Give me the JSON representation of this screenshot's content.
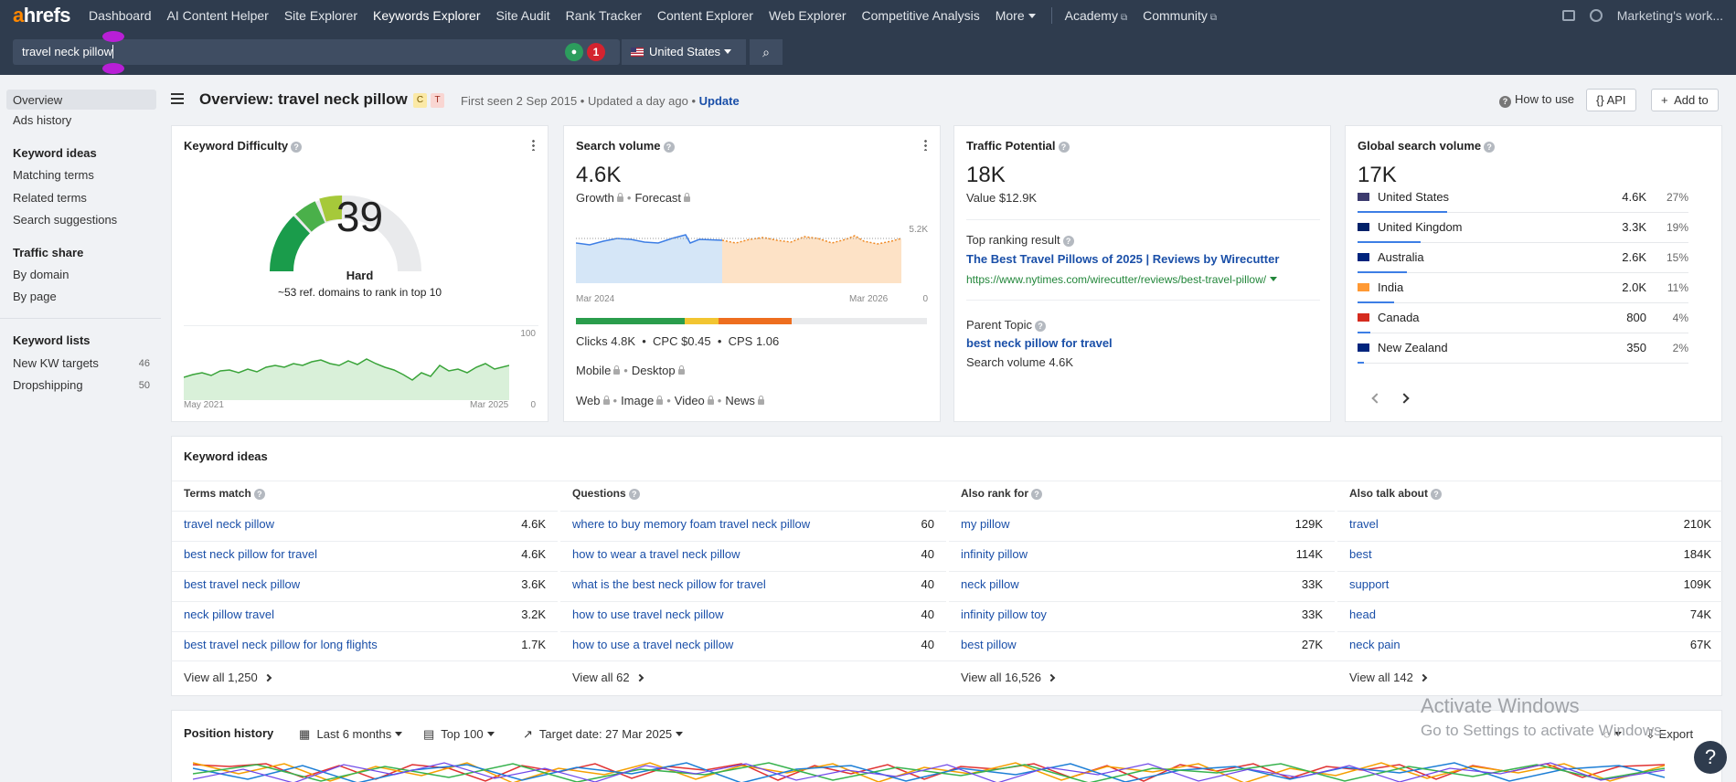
{
  "nav": {
    "logo_a": "a",
    "logo_rest": "hrefs",
    "items": [
      "Dashboard",
      "AI Content Helper",
      "Site Explorer",
      "Keywords Explorer",
      "Site Audit",
      "Rank Tracker",
      "Content Explorer",
      "Web Explorer",
      "Competitive Analysis",
      "More"
    ],
    "academy": "Academy",
    "community": "Community",
    "workspace": "Marketing's work..."
  },
  "search": {
    "query": "travel neck pillow",
    "badge_count": "1",
    "country": "United States"
  },
  "sidebar": {
    "overview": "Overview",
    "ads_history": "Ads history",
    "keyword_ideas_head": "Keyword ideas",
    "matching_terms": "Matching terms",
    "related_terms": "Related terms",
    "search_suggestions": "Search suggestions",
    "traffic_share_head": "Traffic share",
    "by_domain": "By domain",
    "by_page": "By page",
    "keyword_lists_head": "Keyword lists",
    "list1": {
      "name": "New KW targets",
      "count": "46"
    },
    "list2": {
      "name": "Dropshipping",
      "count": "50"
    }
  },
  "header": {
    "title": "Overview: travel neck pillow",
    "tag_c": "C",
    "tag_t": "T",
    "meta": "First seen 2 Sep 2015 • Updated a day ago •",
    "update": "Update",
    "how_to_use": "How to use",
    "api": "API",
    "add_to": "Add to"
  },
  "kd": {
    "title": "Keyword Difficulty",
    "value": "39",
    "label": "Hard",
    "note": "~53 ref. domains to rank in top 10",
    "axis_max": "100",
    "axis_min": "0",
    "date_start": "May 2021",
    "date_end": "Mar 2025"
  },
  "sv": {
    "title": "Search volume",
    "value": "4.6K",
    "growth": "Growth",
    "forecast": "Forecast",
    "axis_max": "5.2K",
    "axis_min": "0",
    "date_start": "Mar 2024",
    "date_end": "Mar 2026",
    "metrics": "Clicks 4.8K  •  CPC $0.45  •  CPS 1.06",
    "mobile": "Mobile",
    "desktop": "Desktop",
    "web": "Web",
    "image": "Image",
    "video": "Video",
    "news": "News"
  },
  "tp": {
    "title": "Traffic Potential",
    "value": "18K",
    "value_usd": "Value $12.9K",
    "top_label": "Top ranking result",
    "top_title": "The Best Travel Pillows of 2025 | Reviews by Wirecutter",
    "top_url": "https://www.nytimes.com/wirecutter/reviews/best-travel-pillow/",
    "parent_label": "Parent Topic",
    "parent_kw": "best neck pillow for travel",
    "parent_sv": "Search volume 4.6K"
  },
  "gsv": {
    "title": "Global search volume",
    "value": "17K",
    "rows": [
      {
        "name": "United States",
        "vol": "4.6K",
        "pct": "27%",
        "share": 0.27,
        "flag": "us"
      },
      {
        "name": "United Kingdom",
        "vol": "3.3K",
        "pct": "19%",
        "share": 0.19,
        "flag": "uk"
      },
      {
        "name": "Australia",
        "vol": "2.6K",
        "pct": "15%",
        "share": 0.15,
        "flag": "au"
      },
      {
        "name": "India",
        "vol": "2.0K",
        "pct": "11%",
        "share": 0.11,
        "flag": "in"
      },
      {
        "name": "Canada",
        "vol": "800",
        "pct": "4%",
        "share": 0.04,
        "flag": "ca"
      },
      {
        "name": "New Zealand",
        "vol": "350",
        "pct": "2%",
        "share": 0.02,
        "flag": "nz"
      }
    ]
  },
  "ki": {
    "title": "Keyword ideas",
    "cols": [
      {
        "head": "Terms match",
        "rows": [
          [
            "travel neck pillow",
            "4.6K"
          ],
          [
            "best neck pillow for travel",
            "4.6K"
          ],
          [
            "best travel neck pillow",
            "3.6K"
          ],
          [
            "neck pillow travel",
            "3.2K"
          ],
          [
            "best travel neck pillow for long flights",
            "1.7K"
          ]
        ],
        "view_all": "View all 1,250"
      },
      {
        "head": "Questions",
        "rows": [
          [
            "where to buy memory foam travel neck pillow",
            "60"
          ],
          [
            "how to wear a travel neck pillow",
            "40"
          ],
          [
            "what is the best neck pillow for travel",
            "40"
          ],
          [
            "how to use travel neck pillow",
            "40"
          ],
          [
            "how to use a travel neck pillow",
            "40"
          ]
        ],
        "view_all": "View all 62"
      },
      {
        "head": "Also rank for",
        "rows": [
          [
            "my pillow",
            "129K"
          ],
          [
            "infinity pillow",
            "114K"
          ],
          [
            "neck pillow",
            "33K"
          ],
          [
            "infinity pillow toy",
            "33K"
          ],
          [
            "best pillow",
            "27K"
          ]
        ],
        "view_all": "View all 16,526"
      },
      {
        "head": "Also talk about",
        "rows": [
          [
            "travel",
            "210K"
          ],
          [
            "best",
            "184K"
          ],
          [
            "support",
            "109K"
          ],
          [
            "head",
            "74K"
          ],
          [
            "neck pain",
            "67K"
          ]
        ],
        "view_all": "View all 142"
      }
    ]
  },
  "ph": {
    "title": "Position history",
    "range": "Last 6 months",
    "top": "Top 100",
    "target": "Target date: 27 Mar 2025",
    "export": "Export"
  },
  "watermark": {
    "line1": "Activate Windows",
    "line2": "Go to Settings to activate Windows."
  },
  "help": "?",
  "colors": {
    "nav_bg": "#2f3c4e",
    "link": "#1a4fa8",
    "accent_orange": "#ff8800"
  }
}
